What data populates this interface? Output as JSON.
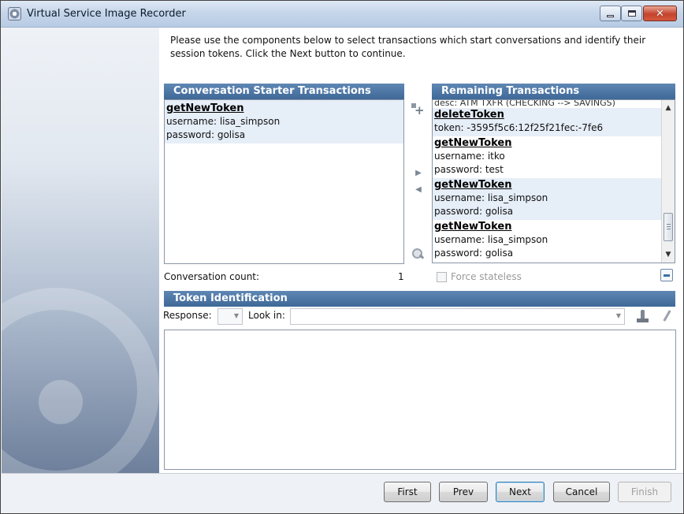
{
  "window": {
    "title": "Virtual Service Image Recorder"
  },
  "intro": {
    "text": "Please use the components below to select transactions which start conversations and identify their session tokens.  Click the Next button to continue."
  },
  "starter": {
    "header": "Conversation Starter Transactions",
    "items": [
      {
        "name": "getNewToken",
        "lines": [
          "username: lisa_simpson",
          "password: golisa"
        ]
      }
    ]
  },
  "remaining": {
    "header": "Remaining Transactions",
    "partial_top": "desc: ATM TXFR (CHECKING --> SAVINGS)",
    "items": [
      {
        "name": "deleteToken",
        "lines": [
          "token: -3595f5c6:12f25f21fec:-7fe6"
        ]
      },
      {
        "name": "getNewToken",
        "lines": [
          "username: itko",
          "password: test"
        ]
      },
      {
        "name": "getNewToken",
        "lines": [
          "username: lisa_simpson",
          "password: golisa"
        ]
      },
      {
        "name": "getNewToken",
        "lines": [
          "username: lisa_simpson",
          "password: golisa"
        ]
      }
    ]
  },
  "conversation": {
    "count_label": "Conversation count:",
    "count_value": "1",
    "force_stateless_label": "Force stateless"
  },
  "token": {
    "header": "Token Identification",
    "response_label": "Response:",
    "lookin_label": "Look in:"
  },
  "buttons": {
    "first": "First",
    "prev": "Prev",
    "next": "Next",
    "cancel": "Cancel",
    "finish": "Finish"
  },
  "icons": {
    "app": "recorder-icon",
    "add": "add-transaction-icon",
    "move_right": "arrow-right-icon",
    "move_left": "arrow-left-icon",
    "search": "magnifier-icon",
    "export": "export-icon",
    "stamp": "stamp-icon",
    "pen": "pen-icon"
  },
  "colors": {
    "header_bg": "#4a739f",
    "alt_row": "#e6eef8",
    "close_button": "#c4442c"
  }
}
